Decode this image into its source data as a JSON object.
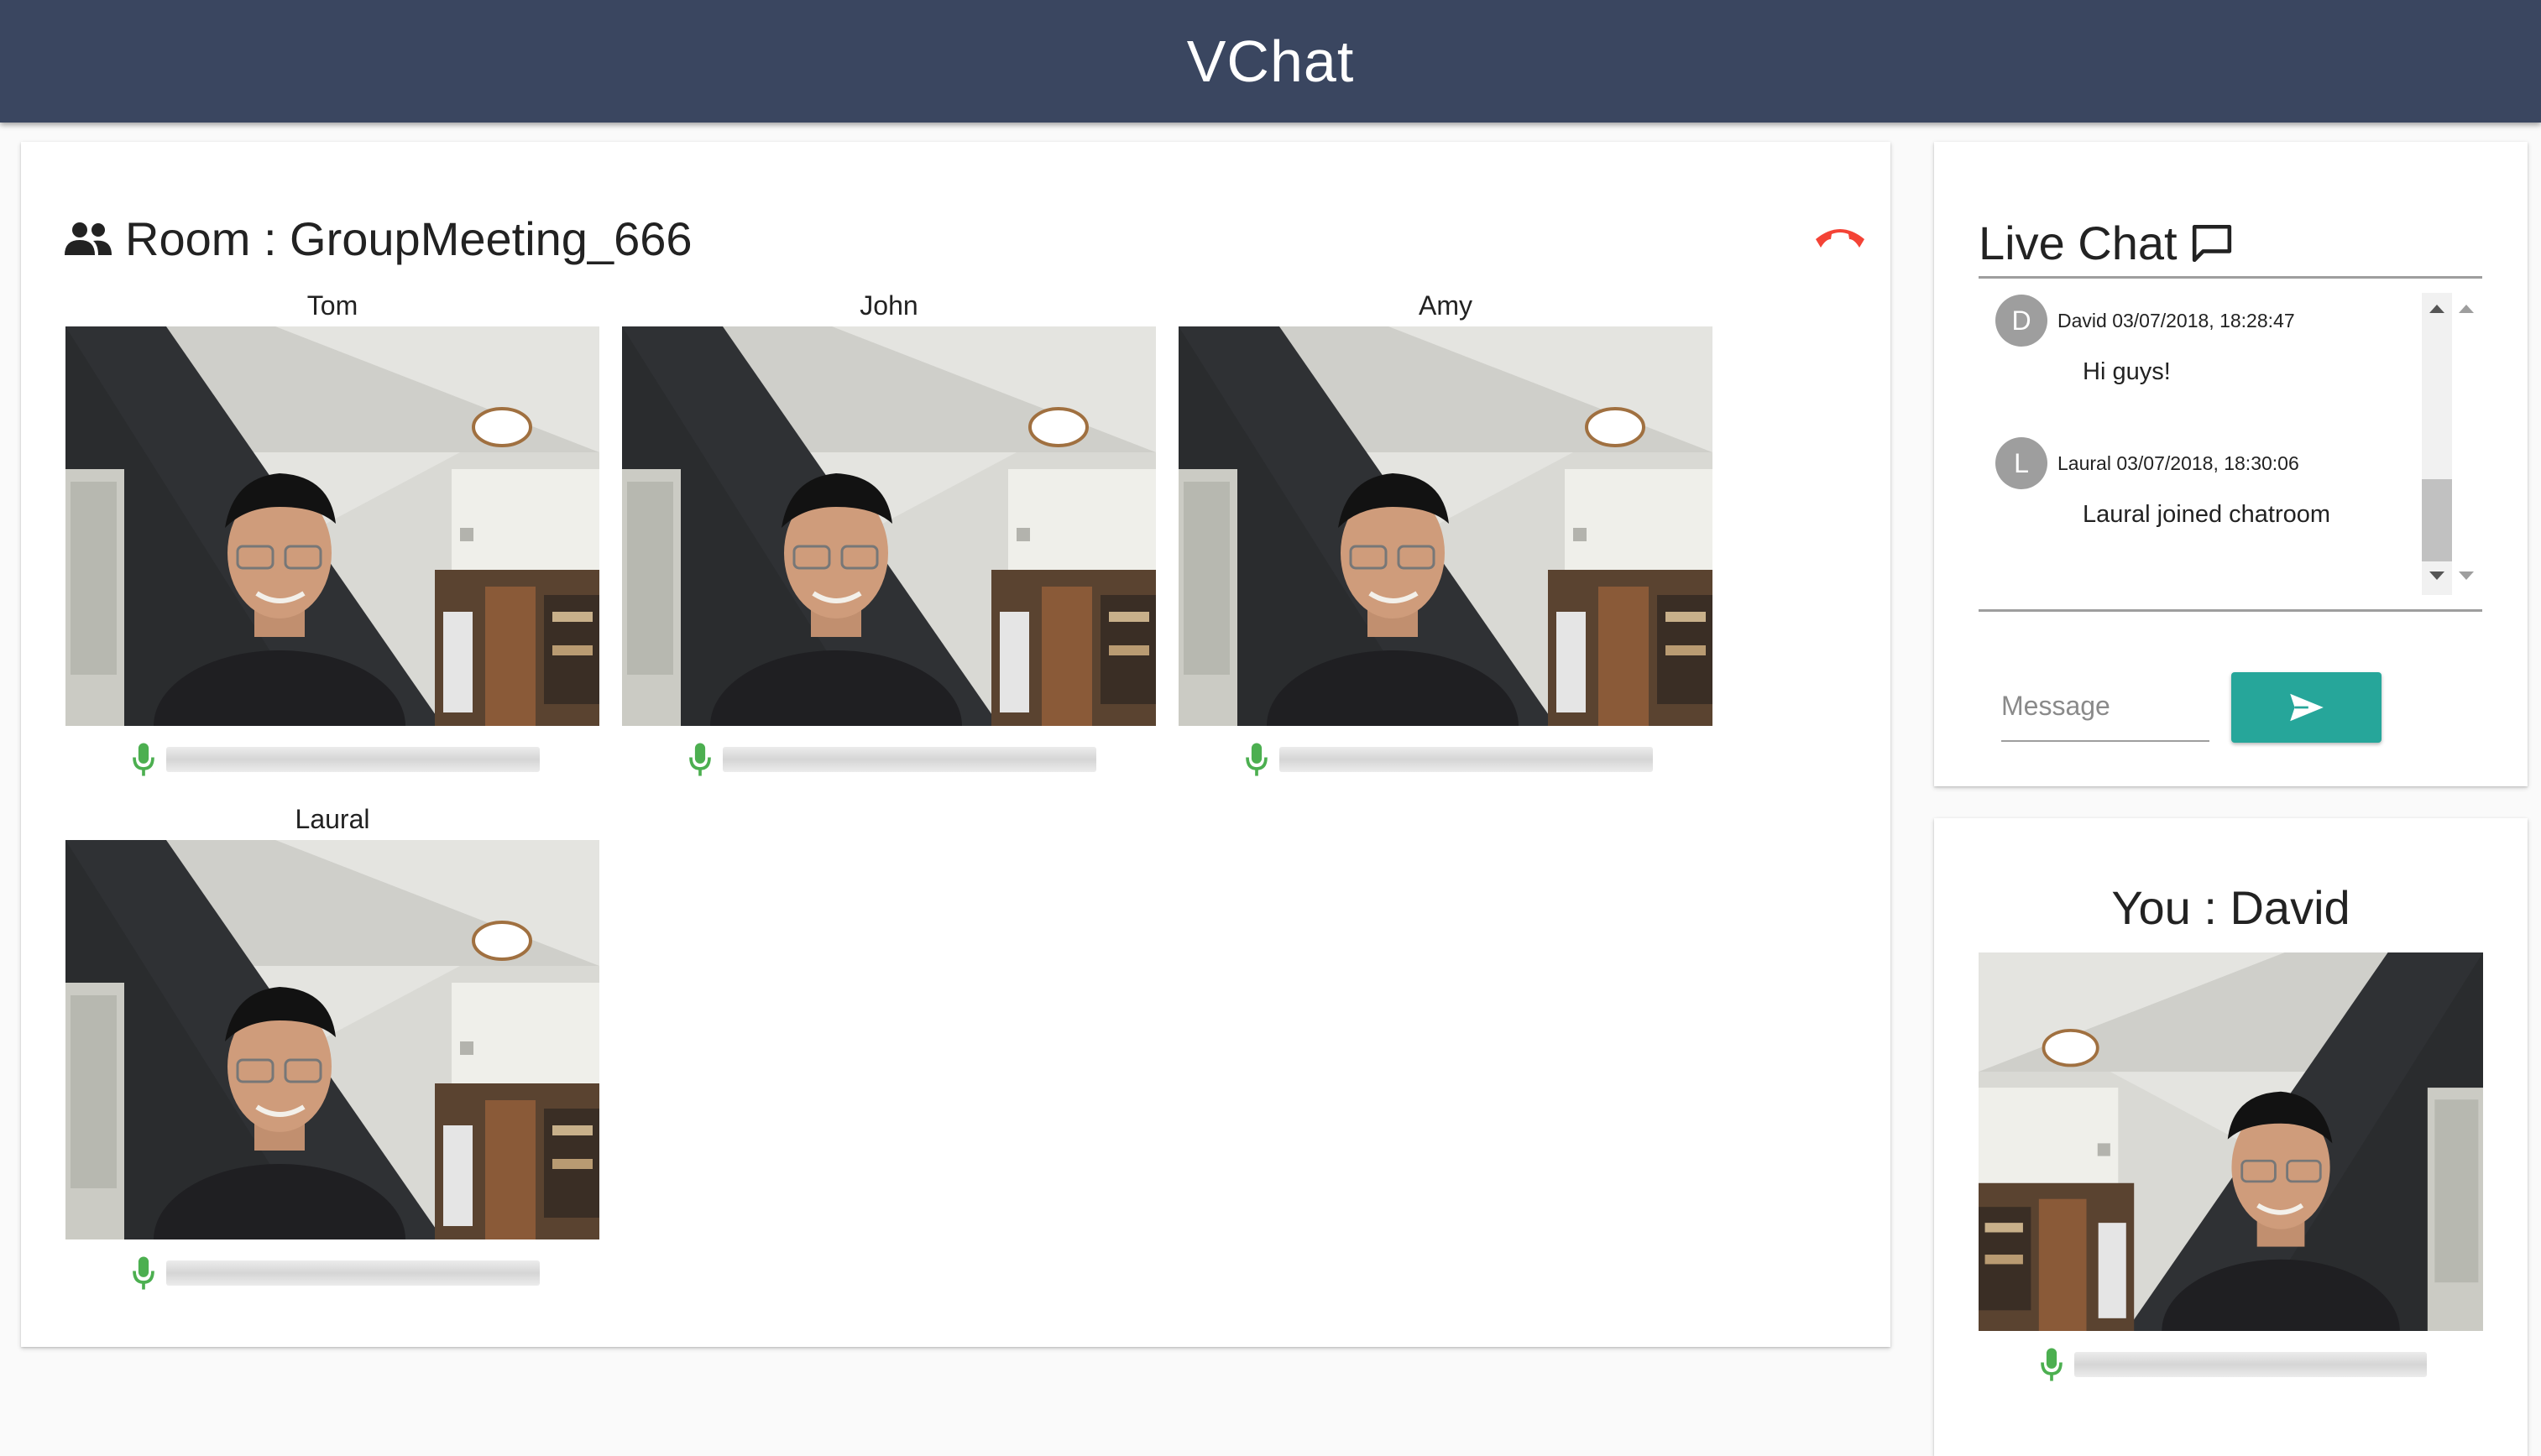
{
  "app": {
    "title": "VChat"
  },
  "room": {
    "title": "Room : GroupMeeting_666",
    "participants": [
      {
        "name": "Tom",
        "audio_level": 0
      },
      {
        "name": "John",
        "audio_level": 0
      },
      {
        "name": "Amy",
        "audio_level": 0
      },
      {
        "name": "Laural",
        "audio_level": 0
      }
    ]
  },
  "chat": {
    "title": "Live Chat",
    "messages": [
      {
        "initial": "D",
        "meta": "David 03/07/2018, 18:28:47",
        "text": "Hi guys!"
      },
      {
        "initial": "L",
        "meta": "Laural 03/07/2018, 18:30:06",
        "text": "Laural joined chatroom"
      }
    ],
    "input_placeholder": "Message",
    "input_value": ""
  },
  "self": {
    "title": "You : David",
    "audio_level": 0
  },
  "colors": {
    "appbar": "#3a4660",
    "mic": "#4caf50",
    "hangup": "#f44336",
    "send_button": "#26a69a"
  },
  "icons": {
    "room": "people-icon",
    "hangup": "hangup-phone-icon",
    "chat": "chat-bubble-icon",
    "mic": "mic-icon",
    "send": "send-icon"
  }
}
